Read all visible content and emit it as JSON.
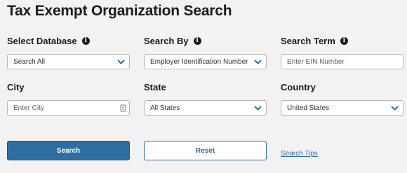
{
  "page": {
    "title": "Tax Exempt Organization Search"
  },
  "labels": {
    "select_database": "Select Database",
    "search_by": "Search By",
    "search_term": "Search Term",
    "city": "City",
    "state": "State",
    "country": "Country"
  },
  "fields": {
    "database_value": "Search All",
    "search_by_value": "Employer Identification Number",
    "search_term_placeholder": "Enter EIN Number",
    "city_placeholder": "Enter City",
    "state_value": "All States",
    "country_value": "United States"
  },
  "buttons": {
    "search": "Search",
    "reset": "Reset"
  },
  "links": {
    "search_tips": "Search Tips"
  },
  "icons": {
    "info": "info-circle-icon",
    "chevron": "chevron-down-icon",
    "autofill": "autofill-key-icon"
  },
  "colors": {
    "primary": "#2e6fa3",
    "background": "#f2f2f2"
  }
}
